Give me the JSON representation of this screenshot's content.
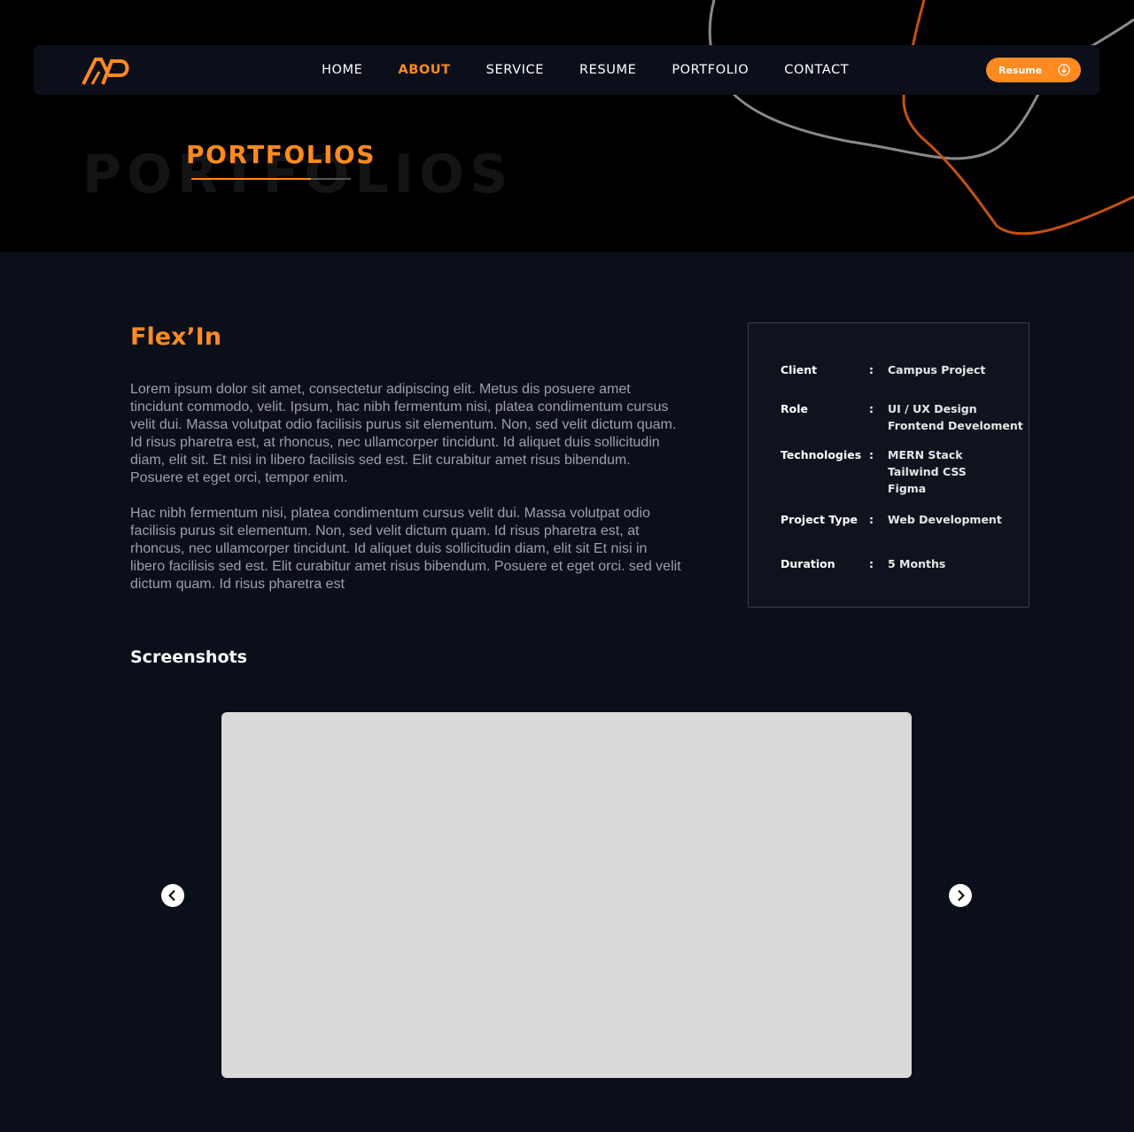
{
  "brand": {
    "logo_text": "AP",
    "accent_color": "#ff8a1f"
  },
  "nav": {
    "links": [
      {
        "label": "HOME",
        "active": false
      },
      {
        "label": "ABOUT",
        "active": true
      },
      {
        "label": "SERVICE",
        "active": false
      },
      {
        "label": "RESUME",
        "active": false
      },
      {
        "label": "PORTFOLIO",
        "active": false
      },
      {
        "label": "CONTACT",
        "active": false
      }
    ],
    "resume_button": {
      "label": "Resume",
      "icon": "download-icon"
    }
  },
  "hero": {
    "ghost_title": "PORTFOLIOS",
    "title": "PORTFOLIOS"
  },
  "project": {
    "name": "Flex’In",
    "paragraphs": [
      "Lorem ipsum dolor sit amet, consectetur adipiscing elit. Metus dis posuere amet tincidunt commodo, velit. Ipsum, hac nibh fermentum nisi, platea condimentum cursus velit dui. Massa volutpat odio facilisis purus sit elementum. Non, sed velit dictum quam. Id risus pharetra est, at rhoncus, nec ullamcorper tincidunt. Id aliquet duis sollicitudin diam, elit sit. Et nisi in libero facilisis sed est. Elit curabitur amet risus bibendum. Posuere et eget orci, tempor enim.",
      "Hac nibh fermentum nisi, platea condimentum cursus velit dui. Massa volutpat odio facilisis purus sit elementum. Non, sed velit dictum quam. Id risus pharetra est, at rhoncus, nec ullamcorper tincidunt. Id aliquet duis sollicitudin diam, elit sit Et nisi in libero facilisis sed est. Elit curabitur amet risus bibendum. Posuere et eget orci. sed velit dictum quam. Id risus pharetra est"
    ]
  },
  "details": {
    "separator": ":",
    "rows": [
      {
        "key": "Client",
        "values": [
          "Campus Project"
        ]
      },
      {
        "key": "Role",
        "values": [
          "UI / UX Design",
          "Frontend Develoment"
        ]
      },
      {
        "key": "Technologies",
        "values": [
          "MERN Stack",
          "Tailwind CSS",
          "Figma"
        ]
      },
      {
        "key": "Project Type",
        "values": [
          "Web Development"
        ]
      },
      {
        "key": "Duration",
        "values": [
          "5 Months"
        ]
      }
    ]
  },
  "screenshots": {
    "heading": "Screenshots",
    "prev_icon": "chevron-left-icon",
    "next_icon": "chevron-right-icon"
  }
}
